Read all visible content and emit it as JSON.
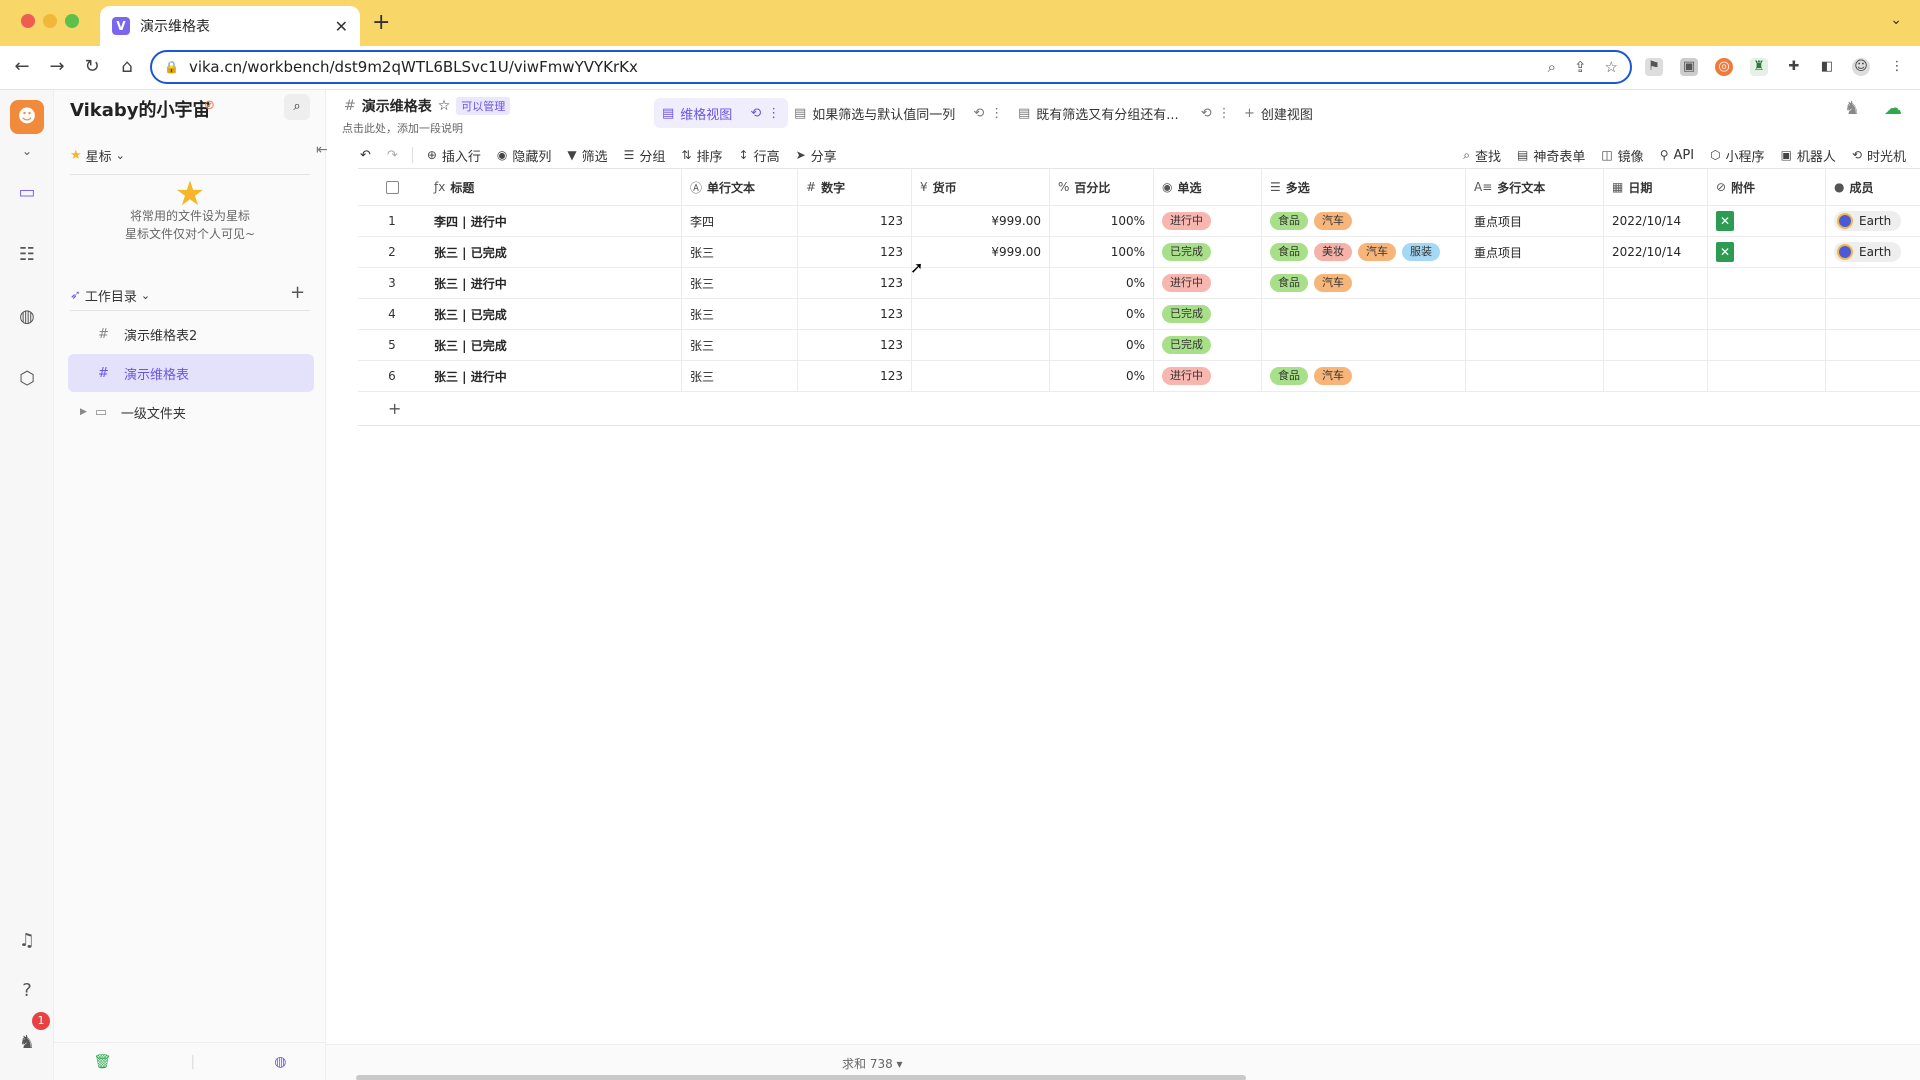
{
  "browser": {
    "tab_title": "演示维格表",
    "url": "vika.cn/workbench/dst9m2qWTL6BLSvc1U/viwFmwYVYKrKx"
  },
  "rail": {
    "notification_count": "1"
  },
  "sidebar": {
    "space_name": "Vikaby的小宇宙",
    "starred_label": "星标",
    "starred_empty_line1": "将常用的文件设为星标",
    "starred_empty_line2": "星标文件仅对个人可见~",
    "workdir_label": "工作目录",
    "items": [
      {
        "label": "演示维格表2",
        "icon": "#"
      },
      {
        "label": "演示维格表",
        "icon": "#"
      },
      {
        "label": "一级文件夹",
        "icon": "▭"
      }
    ]
  },
  "header": {
    "title": "演示维格表",
    "permission": "可以管理",
    "description": "点击此处，添加一段说明",
    "views": [
      {
        "label": "维格视图"
      },
      {
        "label": "如果筛选与默认值同一列"
      },
      {
        "label": "既有筛选又有分组还有..."
      }
    ],
    "create_view": "创建视图"
  },
  "toolbar": {
    "left": [
      "插入行",
      "隐藏列",
      "筛选",
      "分组",
      "排序",
      "行高",
      "分享"
    ],
    "right": [
      "查找",
      "神奇表单",
      "镜像",
      "API",
      "小程序",
      "机器人",
      "时光机"
    ]
  },
  "grid": {
    "columns": [
      "标题",
      "单行文本",
      "数字",
      "货币",
      "百分比",
      "单选",
      "多选",
      "多行文本",
      "日期",
      "附件",
      "成员"
    ],
    "rows": [
      {
        "idx": "1",
        "title": "李四 | 进行中",
        "text": "李四",
        "number": "123",
        "currency": "¥999.00",
        "percent": "100%",
        "status": "进行中",
        "tags": [
          "食品",
          "汽车"
        ],
        "multiline": "重点项目",
        "date": "2022/10/14",
        "attachment": true,
        "member": "Earth"
      },
      {
        "idx": "2",
        "title": "张三 | 已完成",
        "text": "张三",
        "number": "123",
        "currency": "¥999.00",
        "percent": "100%",
        "status": "已完成",
        "tags": [
          "食品",
          "美妆",
          "汽车",
          "服装"
        ],
        "multiline": "重点项目",
        "date": "2022/10/14",
        "attachment": true,
        "member": "Earth"
      },
      {
        "idx": "3",
        "title": "张三 | 进行中",
        "text": "张三",
        "number": "123",
        "currency": "",
        "percent": "0%",
        "status": "进行中",
        "tags": [
          "食品",
          "汽车"
        ],
        "multiline": "",
        "date": "",
        "attachment": false,
        "member": ""
      },
      {
        "idx": "4",
        "title": "张三 | 已完成",
        "text": "张三",
        "number": "123",
        "currency": "",
        "percent": "0%",
        "status": "已完成",
        "tags": [],
        "multiline": "",
        "date": "",
        "attachment": false,
        "member": ""
      },
      {
        "idx": "5",
        "title": "张三 | 已完成",
        "text": "张三",
        "number": "123",
        "currency": "",
        "percent": "0%",
        "status": "已完成",
        "tags": [],
        "multiline": "",
        "date": "",
        "attachment": false,
        "member": ""
      },
      {
        "idx": "6",
        "title": "张三 | 进行中",
        "text": "张三",
        "number": "123",
        "currency": "",
        "percent": "0%",
        "status": "进行中",
        "tags": [
          "食品",
          "汽车"
        ],
        "multiline": "",
        "date": "",
        "attachment": false,
        "member": ""
      }
    ],
    "status_colors": {
      "进行中": "#f8b6b0",
      "已完成": "#a8e08a"
    },
    "tag_colors": {
      "食品": "#a8e08a",
      "汽车": "#f7b57a",
      "美妆": "#f4b2a8",
      "服装": "#a4d8f5"
    }
  },
  "footer": {
    "sum_label": "求和 738"
  }
}
